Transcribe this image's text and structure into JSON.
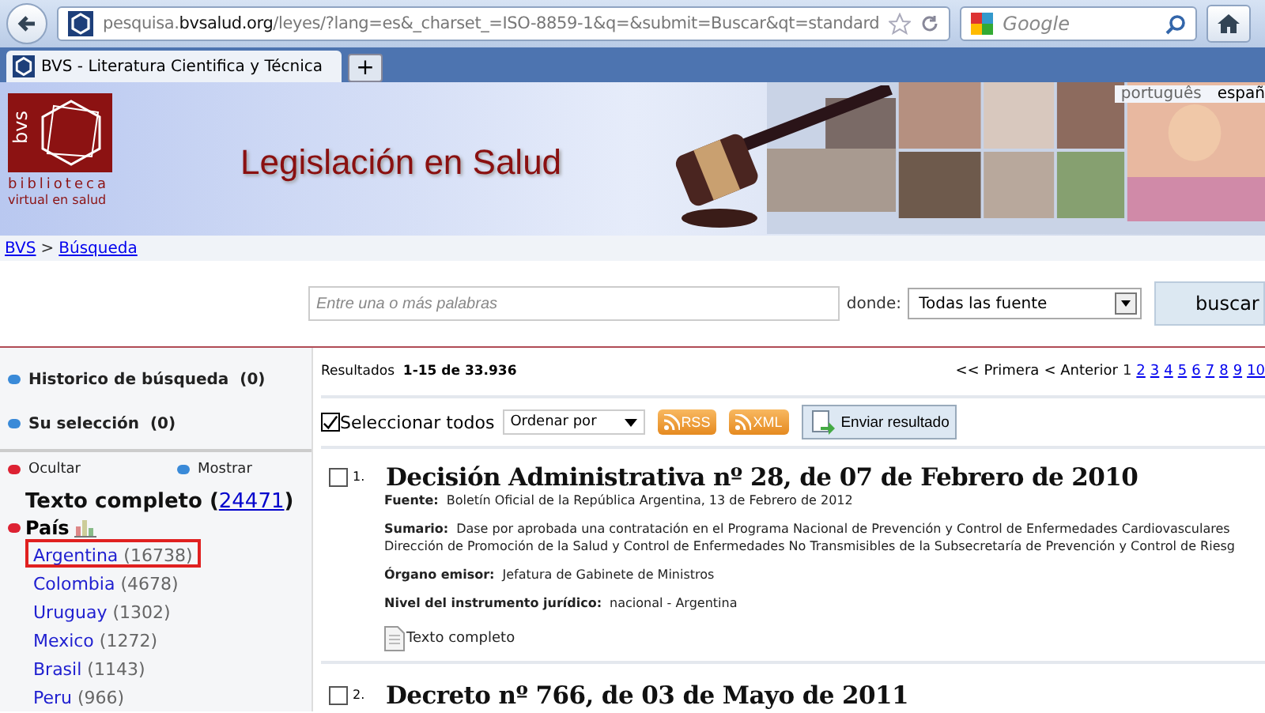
{
  "browser": {
    "url_host_prefix": "pesquisa.",
    "url_domain": "bvsalud.org",
    "url_path": "/leyes/?lang=es&_charset_=ISO-8859-1&q=&submit=Buscar&qt=standard",
    "search_placeholder": "Google",
    "tab_title": "BVS - Literatura Cientifica y Técnica",
    "new_tab": "+"
  },
  "header": {
    "logo_mark": "bvs",
    "logo_line1": "biblioteca",
    "logo_line2": "virtual en salud",
    "title": "Legislación en Salud",
    "languages": [
      {
        "label": "português",
        "selected": false
      },
      {
        "label": "españ",
        "selected": true
      }
    ]
  },
  "breadcrumb": [
    {
      "label": "BVS"
    },
    {
      "label": "Búsqueda"
    }
  ],
  "breadcrumb_separator": ">",
  "search": {
    "placeholder": "Entre una o más palabras",
    "where_label": "donde:",
    "where_value": "Todas las fuente",
    "button": "buscar"
  },
  "sidebar": {
    "panels": [
      {
        "label": "Historico de búsqueda",
        "count": "(0)"
      },
      {
        "label": "Su selección",
        "count": "(0)"
      }
    ],
    "hide": "Ocultar",
    "show": "Mostrar",
    "fulltext_label": "Texto completo (",
    "fulltext_count": "24471",
    "fulltext_close": ")",
    "country_heading": "País",
    "countries": [
      {
        "name": "Argentina",
        "count": "(16738)",
        "highlighted": true
      },
      {
        "name": "Colombia",
        "count": "(4678)",
        "highlighted": false
      },
      {
        "name": "Uruguay",
        "count": "(1302)",
        "highlighted": false
      },
      {
        "name": "Mexico",
        "count": "(1272)",
        "highlighted": false
      },
      {
        "name": "Brasil",
        "count": "(1143)",
        "highlighted": false
      },
      {
        "name": "Peru",
        "count": "(966)",
        "highlighted": false
      }
    ]
  },
  "results": {
    "label": "Resultados",
    "range": "1-15 de 33.936",
    "first": "<< Primera",
    "prev": "< Anterior",
    "pages": [
      {
        "label": "1",
        "selected": true
      },
      {
        "label": "2",
        "selected": false
      },
      {
        "label": "3",
        "selected": false
      },
      {
        "label": "4",
        "selected": false
      },
      {
        "label": "5",
        "selected": false
      },
      {
        "label": "6",
        "selected": false
      },
      {
        "label": "7",
        "selected": false
      },
      {
        "label": "8",
        "selected": false
      },
      {
        "label": "9",
        "selected": false
      },
      {
        "label": "10",
        "selected": false
      }
    ],
    "select_all": {
      "label": "Seleccionar todos",
      "checked": true
    },
    "sort": "Ordenar por",
    "rss": "RSS",
    "xml": "XML",
    "send": "Enviar resultado",
    "items": [
      {
        "number": "1.",
        "checked": false,
        "title": "Decisión Administrativa nº 28, de 07 de Febrero de 2010",
        "fields": [
          {
            "label": "Fuente:",
            "value": "Boletín Oficial de la República Argentina, 13 de Febrero de 2012"
          },
          {
            "label": "Sumario:",
            "value": "Dase por aprobada una contratación en el Programa Nacional de Prevención y Control de Enfermedades Cardiovasculares",
            "value2": "Dirección de Promoción de la Salud y Control de Enfermedades No Transmisibles de la Subsecretaría de Prevención y Control de Riesg"
          },
          {
            "label": "Órgano emisor:",
            "value": "Jefatura de Gabinete de Ministros"
          },
          {
            "label": "Nivel del instrumento jurídico:",
            "value": "nacional - Argentina"
          }
        ],
        "fulltext": "Texto completo"
      },
      {
        "number": "2.",
        "checked": false,
        "title": "Decreto nº 766, de 03 de Mayo de 2011"
      }
    ]
  }
}
